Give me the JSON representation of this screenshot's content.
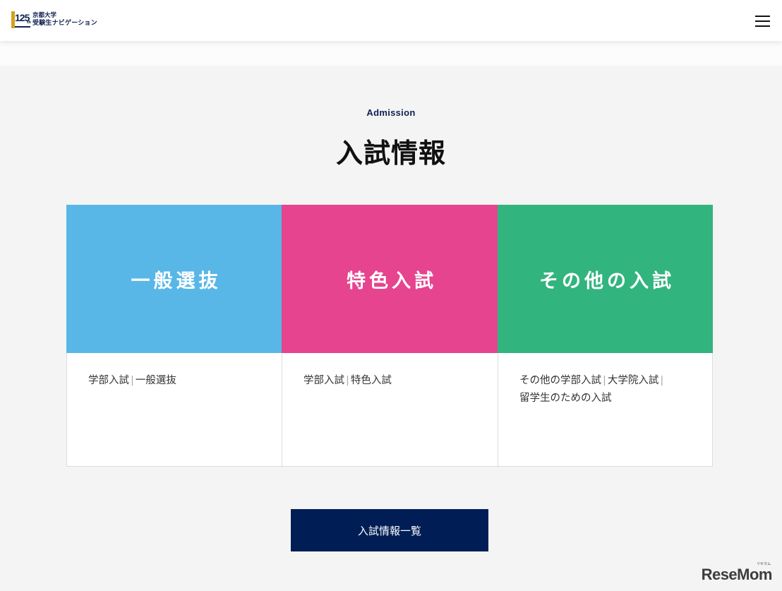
{
  "header": {
    "logo": {
      "mark_number": "125",
      "mark_suffix": "th",
      "line1": "京都大学",
      "line2": "受験生ナビゲーション"
    },
    "menu_icon": "hamburger-icon"
  },
  "section": {
    "eyebrow": "Admission",
    "title": "入試情報"
  },
  "cards": [
    {
      "banner": "一般選抜",
      "color": "#58b7e7",
      "links": [
        "学部入試",
        "一般選抜"
      ]
    },
    {
      "banner": "特色入試",
      "color": "#e6448f",
      "links": [
        "学部入試",
        "特色入試"
      ]
    },
    {
      "banner": "その他の入試",
      "color": "#32b47f",
      "links": [
        "その他の学部入試",
        "大学院入試",
        "留学生のための入試"
      ]
    }
  ],
  "separator": "|",
  "list_button": "入試情報一覧",
  "colors": {
    "navy": "#001e55",
    "background": "#f4f4f4"
  },
  "watermark": {
    "text": "ReseMom",
    "small": "リセマム"
  }
}
